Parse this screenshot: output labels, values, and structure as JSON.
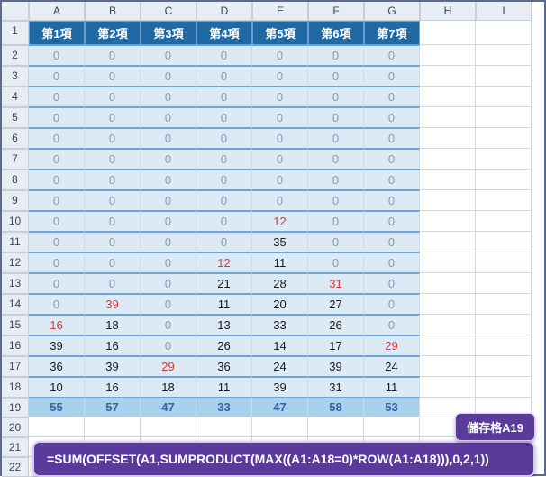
{
  "columns": [
    "",
    "A",
    "B",
    "C",
    "D",
    "E",
    "F",
    "G",
    "H",
    "I"
  ],
  "row_count": 22,
  "headers": [
    "第1項",
    "第2項",
    "第3項",
    "第4項",
    "第5項",
    "第6項",
    "第7項"
  ],
  "chart_data": {
    "type": "table",
    "title": "",
    "columns": [
      "第1項",
      "第2項",
      "第3項",
      "第4項",
      "第5項",
      "第6項",
      "第7項"
    ],
    "rows": [
      [
        0,
        0,
        0,
        0,
        0,
        0,
        0
      ],
      [
        0,
        0,
        0,
        0,
        0,
        0,
        0
      ],
      [
        0,
        0,
        0,
        0,
        0,
        0,
        0
      ],
      [
        0,
        0,
        0,
        0,
        0,
        0,
        0
      ],
      [
        0,
        0,
        0,
        0,
        0,
        0,
        0
      ],
      [
        0,
        0,
        0,
        0,
        0,
        0,
        0
      ],
      [
        0,
        0,
        0,
        0,
        0,
        0,
        0
      ],
      [
        0,
        0,
        0,
        0,
        0,
        0,
        0
      ],
      [
        0,
        0,
        0,
        0,
        12,
        0,
        0
      ],
      [
        0,
        0,
        0,
        0,
        35,
        0,
        0
      ],
      [
        0,
        0,
        0,
        12,
        11,
        0,
        0
      ],
      [
        0,
        0,
        0,
        21,
        28,
        31,
        0
      ],
      [
        0,
        39,
        0,
        11,
        20,
        27,
        0
      ],
      [
        16,
        18,
        0,
        13,
        33,
        26,
        0
      ],
      [
        39,
        16,
        0,
        26,
        14,
        17,
        29
      ],
      [
        36,
        39,
        29,
        36,
        24,
        39,
        24
      ],
      [
        10,
        16,
        18,
        11,
        39,
        31,
        11
      ],
      [
        55,
        57,
        47,
        33,
        47,
        58,
        53
      ]
    ],
    "first_nonzero_marked_red": true
  },
  "callout": {
    "label": "儲存格A19",
    "formula": "=SUM(OFFSET(A1,SUMPRODUCT(MAX((A1:A18=0)*ROW(A1:A18))),0,2,1))"
  }
}
